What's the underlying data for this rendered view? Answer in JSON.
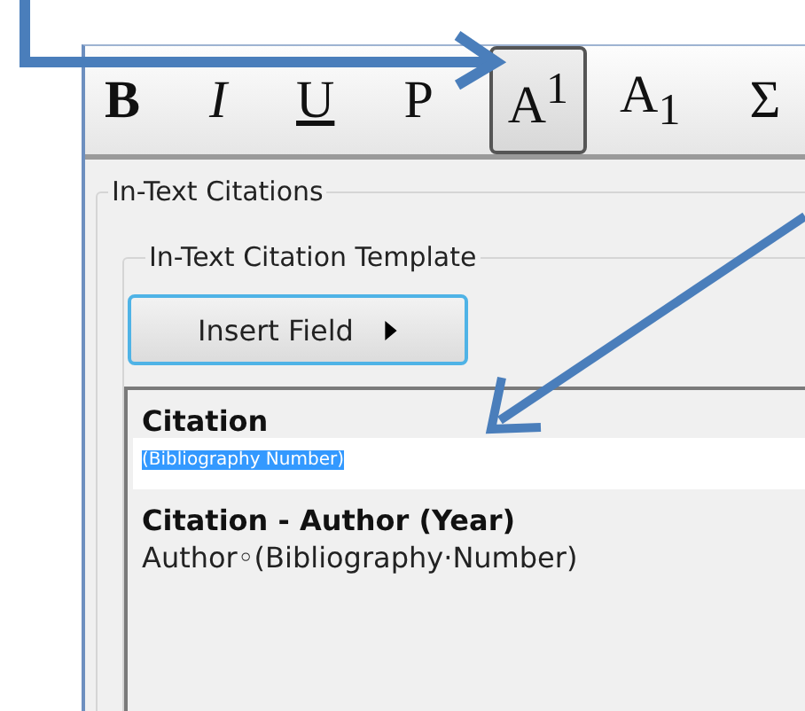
{
  "toolbar": {
    "buttons": [
      {
        "label": "B",
        "kind": "bold",
        "selected": false
      },
      {
        "label": "I",
        "kind": "italic",
        "selected": false
      },
      {
        "label": "U",
        "kind": "underline",
        "selected": false
      },
      {
        "label": "P",
        "kind": "plain",
        "selected": false
      },
      {
        "label": "A$^{1}$",
        "kind": "plain",
        "selected": true
      },
      {
        "label": "A$_{1}$",
        "kind": "plain",
        "selected": false
      },
      {
        "label": "Σ",
        "kind": "plain",
        "selected": false
      }
    ]
  },
  "group": {
    "title": "In-Text Citations",
    "template": {
      "title": "In-Text Citation Template",
      "insert_button": "Insert Field",
      "editor": {
        "entries": [
          {
            "title": "Citation",
            "text": "(Bibliography Number)",
            "selected": true
          },
          {
            "title": "Citation - Author (Year)",
            "text": "Author◦(Bibliography·Number)",
            "selected": false
          }
        ]
      }
    }
  }
}
